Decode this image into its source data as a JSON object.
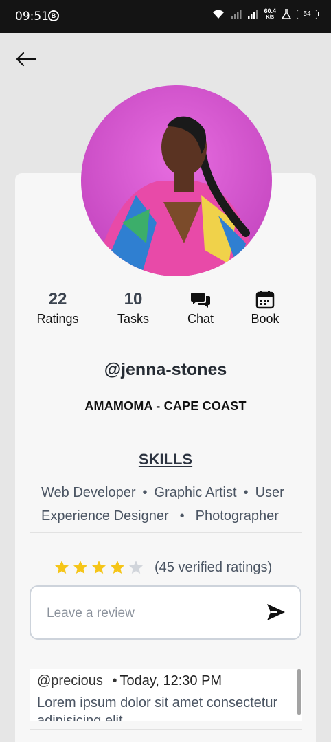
{
  "status_bar": {
    "time": "09:51",
    "b_badge": "B",
    "net_speed_value": "60.4",
    "net_speed_unit": "K/S",
    "battery": "54"
  },
  "profile": {
    "stats": [
      {
        "value": "22",
        "label": "Ratings"
      },
      {
        "value": "10",
        "label": "Tasks"
      }
    ],
    "actions": [
      {
        "label": "Chat",
        "icon": "chat-icon"
      },
      {
        "label": "Book",
        "icon": "calendar-icon"
      }
    ],
    "handle": "@jenna-stones",
    "location": "AMAMOMA - CAPE COAST"
  },
  "skills": {
    "title": "SKILLS",
    "line1": [
      "Web Developer",
      "Graphic Artist",
      "User"
    ],
    "line2": [
      "Experience Designer",
      "Photographer"
    ],
    "separator": "•"
  },
  "rating": {
    "stars": 4,
    "max_stars": 5,
    "text": "(45 verified ratings)",
    "star_color": "#f5c518",
    "empty_star_color": "#d1d5db"
  },
  "review_input": {
    "placeholder": "Leave a review"
  },
  "comments": [
    {
      "user": "@precious",
      "time": "Today, 12:30 PM",
      "text": "Lorem ipsum dolor sit amet consectetur adipisicing elit"
    }
  ],
  "colors": {
    "status_bar": "#141414",
    "background": "#e6e6e6",
    "card": "#f7f7f7",
    "avatar_bg": "#d45ad0"
  }
}
